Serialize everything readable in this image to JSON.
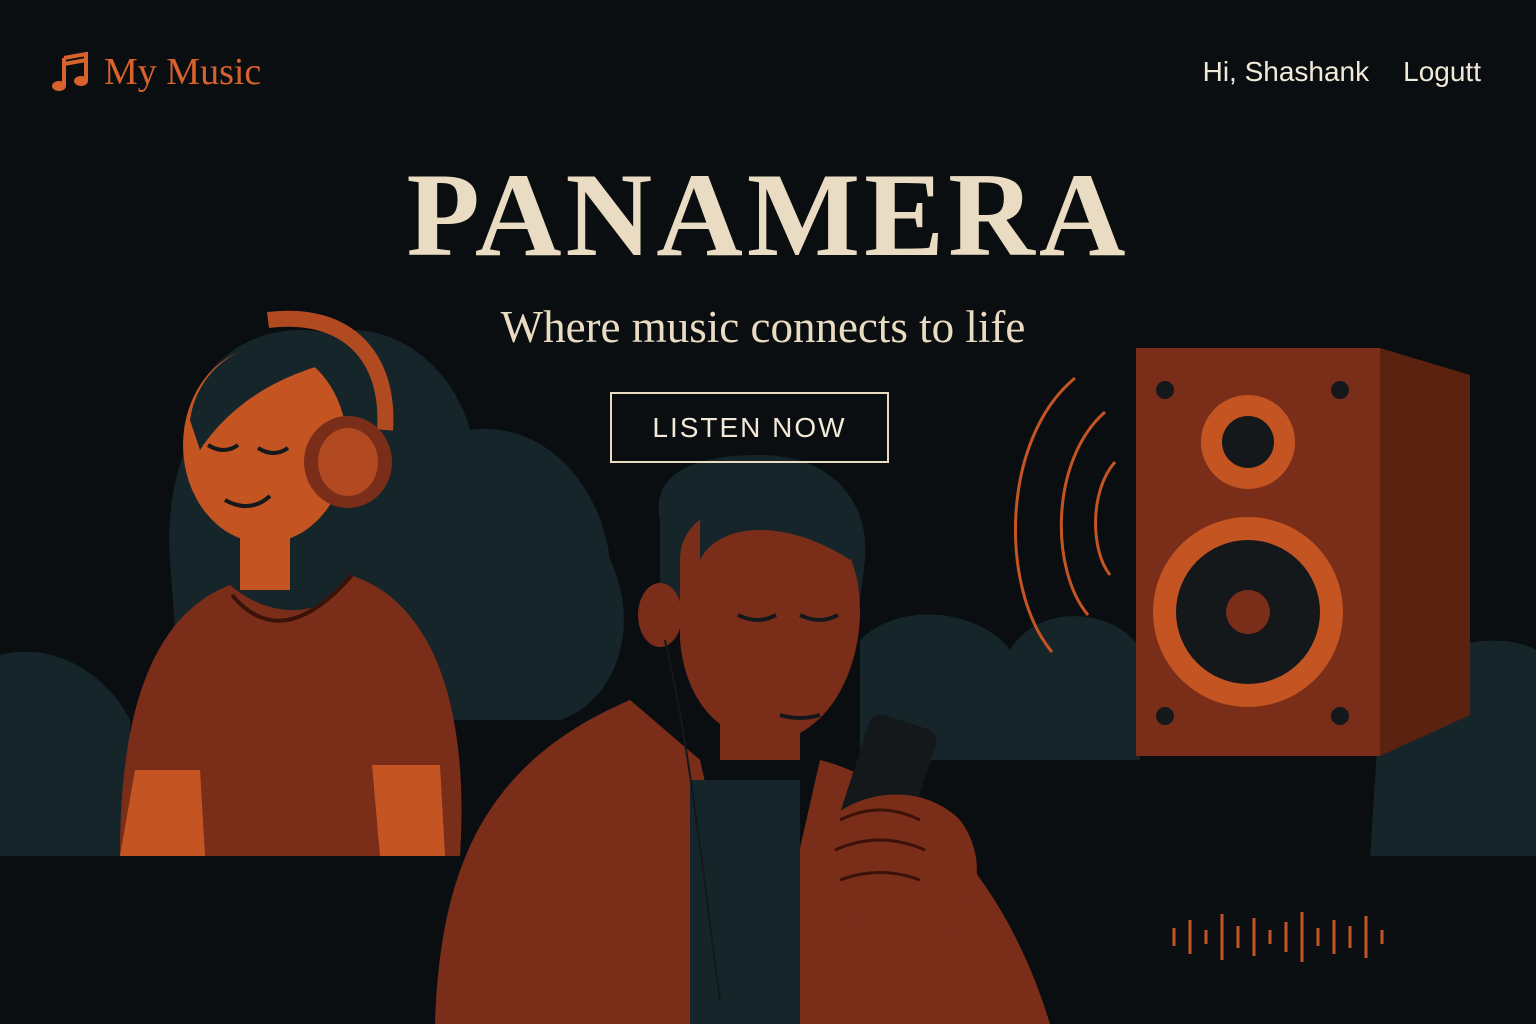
{
  "header": {
    "brand_icon": "music-note-icon",
    "brand_label": "My Music",
    "greeting": "Hi, Shashank",
    "logout_label": "Logutt"
  },
  "hero": {
    "title": "PANAMERA",
    "subtitle": "Where music connects to life",
    "cta_label": "LISTEN NOW"
  },
  "illustration": {
    "elements": [
      "woman-with-headphones",
      "man-with-phone-and-earphones",
      "speaker",
      "sound-waves-icon",
      "audio-waveform-icon"
    ]
  },
  "colors": {
    "background": "#0b0e10",
    "accent": "#d8622c",
    "text_light": "#eadcc2",
    "rust": "#7a2e1a",
    "teal_dark": "#16262b"
  }
}
